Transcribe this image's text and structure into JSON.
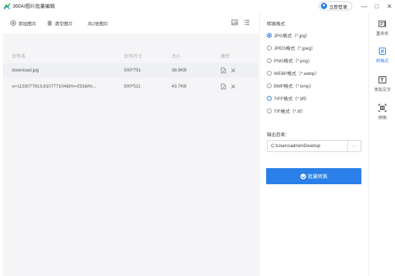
{
  "app": {
    "title": "360AI图片批量编辑",
    "login_label": "立即登录"
  },
  "window": {
    "minimize": "—",
    "maximize": "□",
    "close": "✕"
  },
  "toolbar": {
    "add_label": "添加图片",
    "clear_label": "清空图片",
    "count_label": "共2张图片"
  },
  "table": {
    "headers": {
      "name": "文件名",
      "size_px": "文件尺寸",
      "filesize": "大小",
      "ops": "操作"
    },
    "rows": [
      {
        "name": "download.jpg",
        "size_px": "500*751",
        "filesize": "38.9KB"
      },
      {
        "name": "u=1133077813,610777104&fm=253&fm...",
        "size_px": "500*511",
        "filesize": "43.7KB"
      }
    ]
  },
  "convert": {
    "section_title": "转换格式",
    "formats": [
      "JPG格式（*.jpg）",
      "JPEG格式（*.jpeg）",
      "PNG格式（*.png）",
      "WEBP格式（*.webp）",
      "BMP格式（*.bmp）",
      "TIFF格式（*.tiff）",
      "TIF格式（*.tif）"
    ],
    "output_label": "输出目录：",
    "output_path": "C:\\Users\\admin\\Desktop",
    "browse_label": "···",
    "button_label": "批量转换"
  },
  "sidenav": {
    "items": [
      "重命名",
      "转格式",
      "添加文字",
      "拼图"
    ]
  },
  "colors": {
    "accent": "#2a7fe8"
  }
}
